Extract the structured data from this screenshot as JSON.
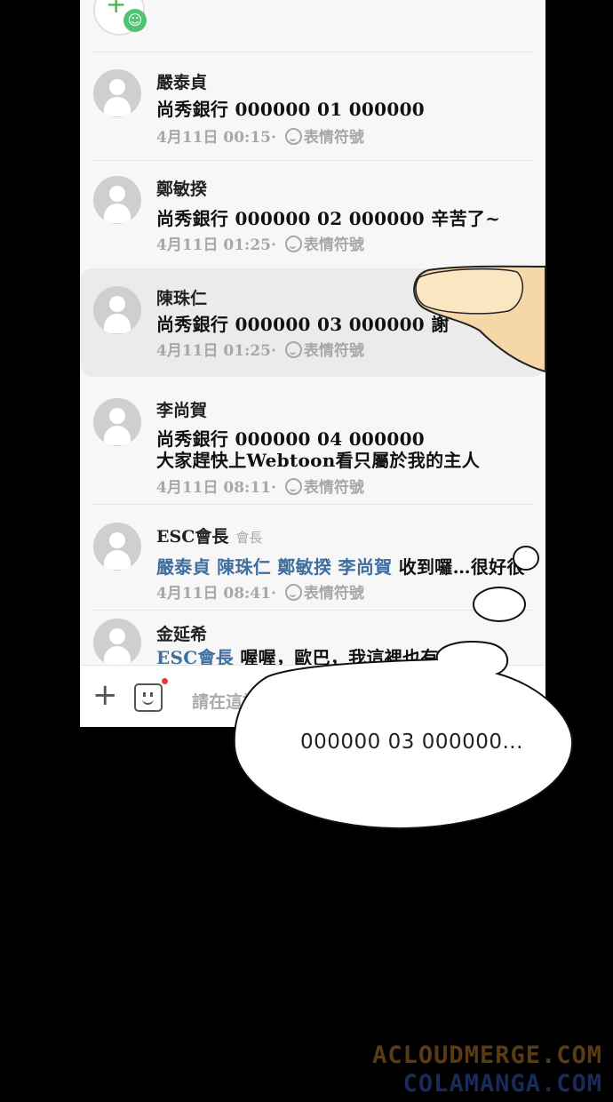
{
  "comments": [
    {
      "name": "嚴泰貞",
      "role": "",
      "mentions": [],
      "text": "尚秀銀行 000000 01 000000",
      "text2": "",
      "time": "4月11日 00:15",
      "emoji_label": "表情符號"
    },
    {
      "name": "鄭敏揆",
      "role": "",
      "mentions": [],
      "text": "尚秀銀行 000000 02 000000 辛苦了~",
      "text2": "",
      "time": "4月11日 01:25",
      "emoji_label": "表情符號"
    },
    {
      "name": "陳珠仁",
      "role": "",
      "mentions": [],
      "text": "尚秀銀行 000000 03 000000 謝",
      "text2": "",
      "time": "4月11日 01:25",
      "emoji_label": "表情符號"
    },
    {
      "name": "李尚賀",
      "role": "",
      "mentions": [],
      "text": "尚秀銀行 000000 04 000000",
      "text2": "大家趕快上Webtoon看只屬於我的主人",
      "time": "4月11日 08:11",
      "emoji_label": "表情符號"
    },
    {
      "name": "ESC會長",
      "role": "會長",
      "mentions": [
        "嚴泰貞",
        "陳珠仁",
        "鄭敏揆",
        "李尚賀"
      ],
      "text": "收到囉…很好很",
      "text2": "",
      "time": "4月11日 08:41",
      "emoji_label": "表情符號"
    },
    {
      "name": "金延希",
      "role": "",
      "mentions": [
        "ESC會長"
      ],
      "text": "喔喔，歐巴，我這裡也有",
      "text2": "",
      "time": "",
      "emoji_label": ""
    }
  ],
  "input": {
    "placeholder": "請在這裡"
  },
  "speech_bubble": {
    "text": "000000 03 000000..."
  },
  "watermark": {
    "line1": "ACLOUDMERGE.COM",
    "line2": "COLAMANGA.COM"
  },
  "colors": {
    "mention": "#3f6f9e",
    "badge_green": "#4cc470",
    "notify_red": "#e53935",
    "skin": "#f6d8a8"
  }
}
